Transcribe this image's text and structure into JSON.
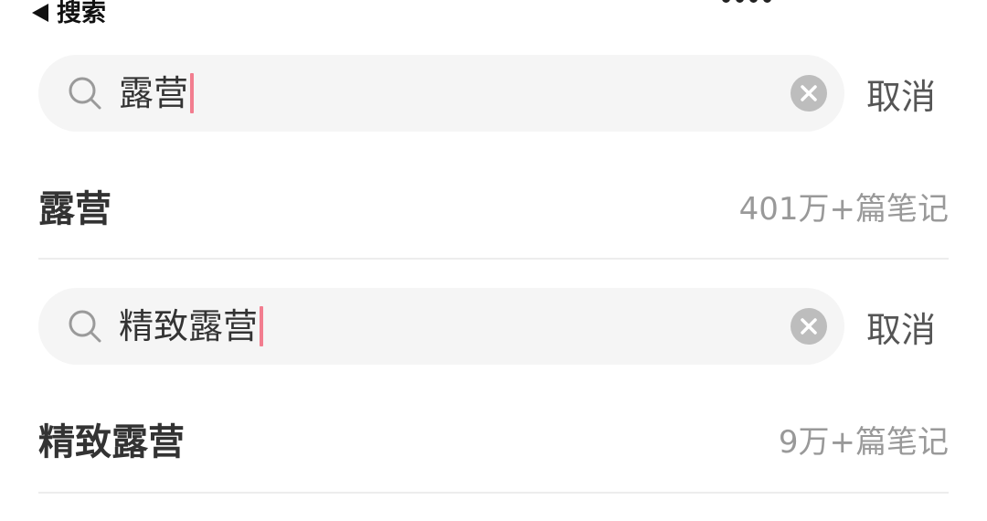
{
  "header": {
    "back_label": "搜索"
  },
  "blocks": [
    {
      "search": {
        "query": "露营",
        "cancel_label": "取消"
      },
      "suggestion": {
        "title": "露营",
        "count": "401万+篇笔记"
      }
    },
    {
      "search": {
        "query": "精致露营",
        "cancel_label": "取消"
      },
      "suggestion": {
        "title": "精致露营",
        "count": "9万+篇笔记"
      }
    }
  ],
  "colors": {
    "caret": "#f27d8f",
    "search_bg": "#f5f5f5",
    "clear_icon": "#bdbdbd",
    "muted_text": "#999999"
  },
  "icons": {
    "back": "triangle-left-icon",
    "search": "magnifier-icon",
    "clear": "clear-circle-x-icon"
  }
}
